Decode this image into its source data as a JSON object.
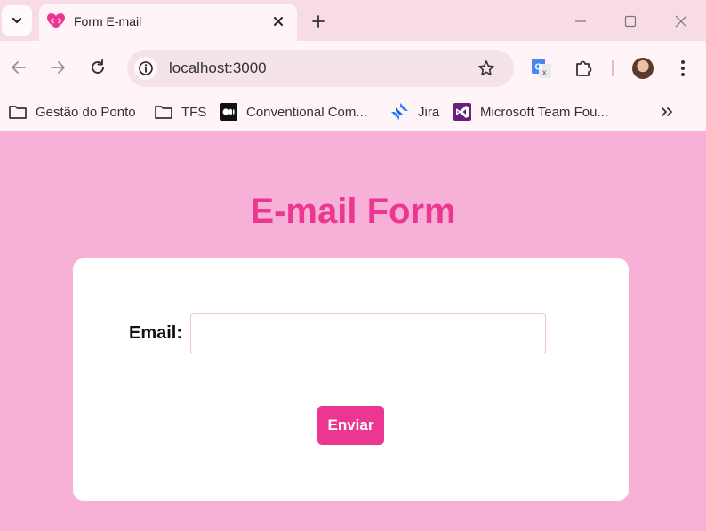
{
  "browser": {
    "tab": {
      "title": "Form E-mail",
      "favicon": "heart-code-icon"
    },
    "address_bar": {
      "url": "localhost:3000"
    },
    "icons": {
      "tab_search": "chevron-down-icon",
      "close_tab": "close-icon",
      "new_tab": "plus-icon",
      "minimize": "minimize-icon",
      "maximize": "maximize-icon",
      "close_window": "close-icon",
      "back": "back-arrow-icon",
      "forward": "forward-arrow-icon",
      "reload": "reload-icon",
      "site_info": "info-icon",
      "bookmark_star": "star-icon",
      "translate": "google-translate-icon",
      "extensions": "puzzle-icon",
      "menu": "kebab-menu-icon",
      "more_bookmarks": "double-chevron-icon"
    },
    "bookmarks": [
      {
        "label": "Gestão do Ponto",
        "icon": "folder-icon"
      },
      {
        "label": "TFS",
        "icon": "folder-icon"
      },
      {
        "label": "Conventional Com...",
        "icon": "medium-icon"
      },
      {
        "label": "Jira",
        "icon": "jira-icon"
      },
      {
        "label": "Microsoft Team Fou...",
        "icon": "visual-studio-icon"
      }
    ]
  },
  "page": {
    "title": "E-mail Form",
    "form": {
      "email_label": "Email:",
      "email_value": "",
      "submit_label": "Enviar"
    }
  },
  "colors": {
    "page_background": "#f7b0d6",
    "accent": "#ec3792",
    "card": "#ffffff",
    "browser_chrome": "#f7dbe6"
  }
}
